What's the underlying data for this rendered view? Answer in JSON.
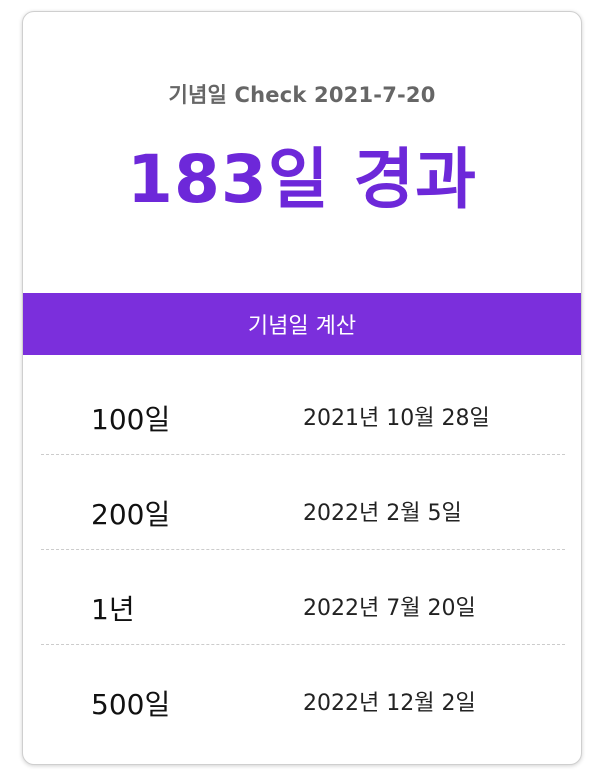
{
  "header": {
    "check_text": "기념일 Check 2021-7-20",
    "elapsed_text": "183일 경과"
  },
  "calc_button": {
    "label": "기념일 계산"
  },
  "milestones": [
    {
      "label": "100일",
      "date": "2021년 10월 28일"
    },
    {
      "label": "200일",
      "date": "2022년 2월 5일"
    },
    {
      "label": "1년",
      "date": "2022년 7월 20일"
    },
    {
      "label": "500일",
      "date": "2022년 12월 2일"
    }
  ],
  "colors": {
    "accent": "#7b2fdc",
    "elapsed_text": "#6d28d9",
    "subtitle": "#666666"
  }
}
